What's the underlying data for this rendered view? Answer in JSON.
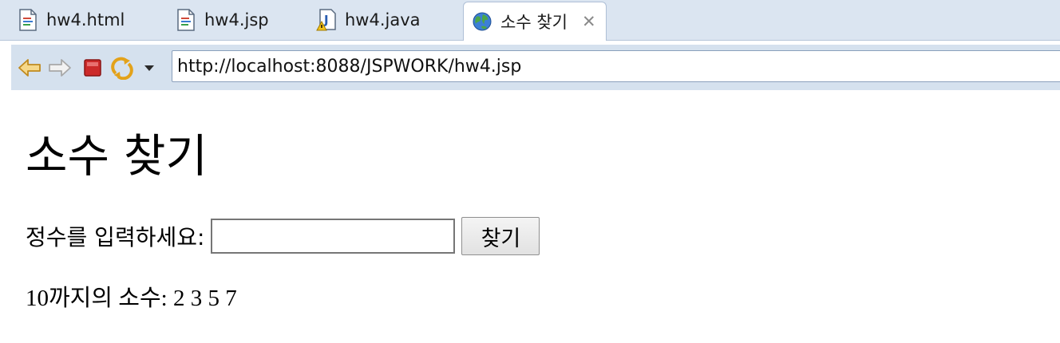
{
  "tabs": [
    {
      "label": "hw4.html",
      "icon": "html-file-icon"
    },
    {
      "label": "hw4.jsp",
      "icon": "jsp-file-icon"
    },
    {
      "label": "hw4.java",
      "icon": "java-file-warning-icon"
    },
    {
      "label": "소수 찾기",
      "icon": "globe-icon",
      "active": true,
      "close": "✕"
    }
  ],
  "toolbar": {
    "url": "http://localhost:8088/JSPWORK/hw4.jsp"
  },
  "page": {
    "heading": "소수 찾기",
    "input_label": "정수를 입력하세요:",
    "input_value": "",
    "find_button": "찾기",
    "result": "10까지의 소수: 2 3 5 7"
  },
  "colors": {
    "tabbar_bg": "#dbe5f1",
    "toolbar_bg": "#d5e1ee",
    "stop_red": "#cc2a2a"
  }
}
